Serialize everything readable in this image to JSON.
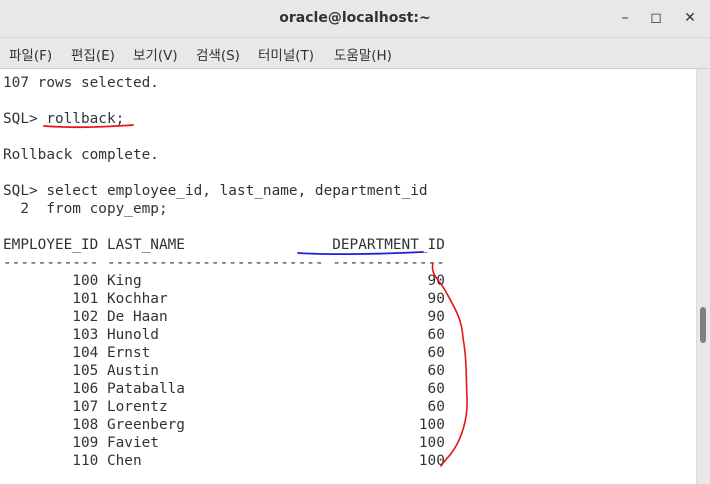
{
  "window": {
    "title": "oracle@localhost:~",
    "minimize_glyph": "–",
    "maximize_glyph": "◻",
    "close_glyph": "✕"
  },
  "menu": [
    "파일(F)",
    "편집(E)",
    "보기(V)",
    "검색(S)",
    "터미널(T)",
    "도움말(H)"
  ],
  "terminal": {
    "lines": [
      "107 rows selected.",
      "",
      "SQL> rollback;",
      "",
      "Rollback complete.",
      "",
      "SQL> select employee_id, last_name, department_id",
      "  2  from copy_emp;",
      "",
      "EMPLOYEE_ID LAST_NAME                 DEPARTMENT_ID",
      "----------- ------------------------- -------------",
      "        100 King                                 90",
      "        101 Kochhar                              90",
      "        102 De Haan                              90",
      "        103 Hunold                               60",
      "        104 Ernst                                60",
      "        105 Austin                               60",
      "        106 Pataballa                            60",
      "        107 Lorentz                              60",
      "        108 Greenberg                           100",
      "        109 Faviet                              100",
      "        110 Chen                                100"
    ]
  },
  "annotation_colors": {
    "red": "#e8141c",
    "blue": "#1f1fd6"
  }
}
